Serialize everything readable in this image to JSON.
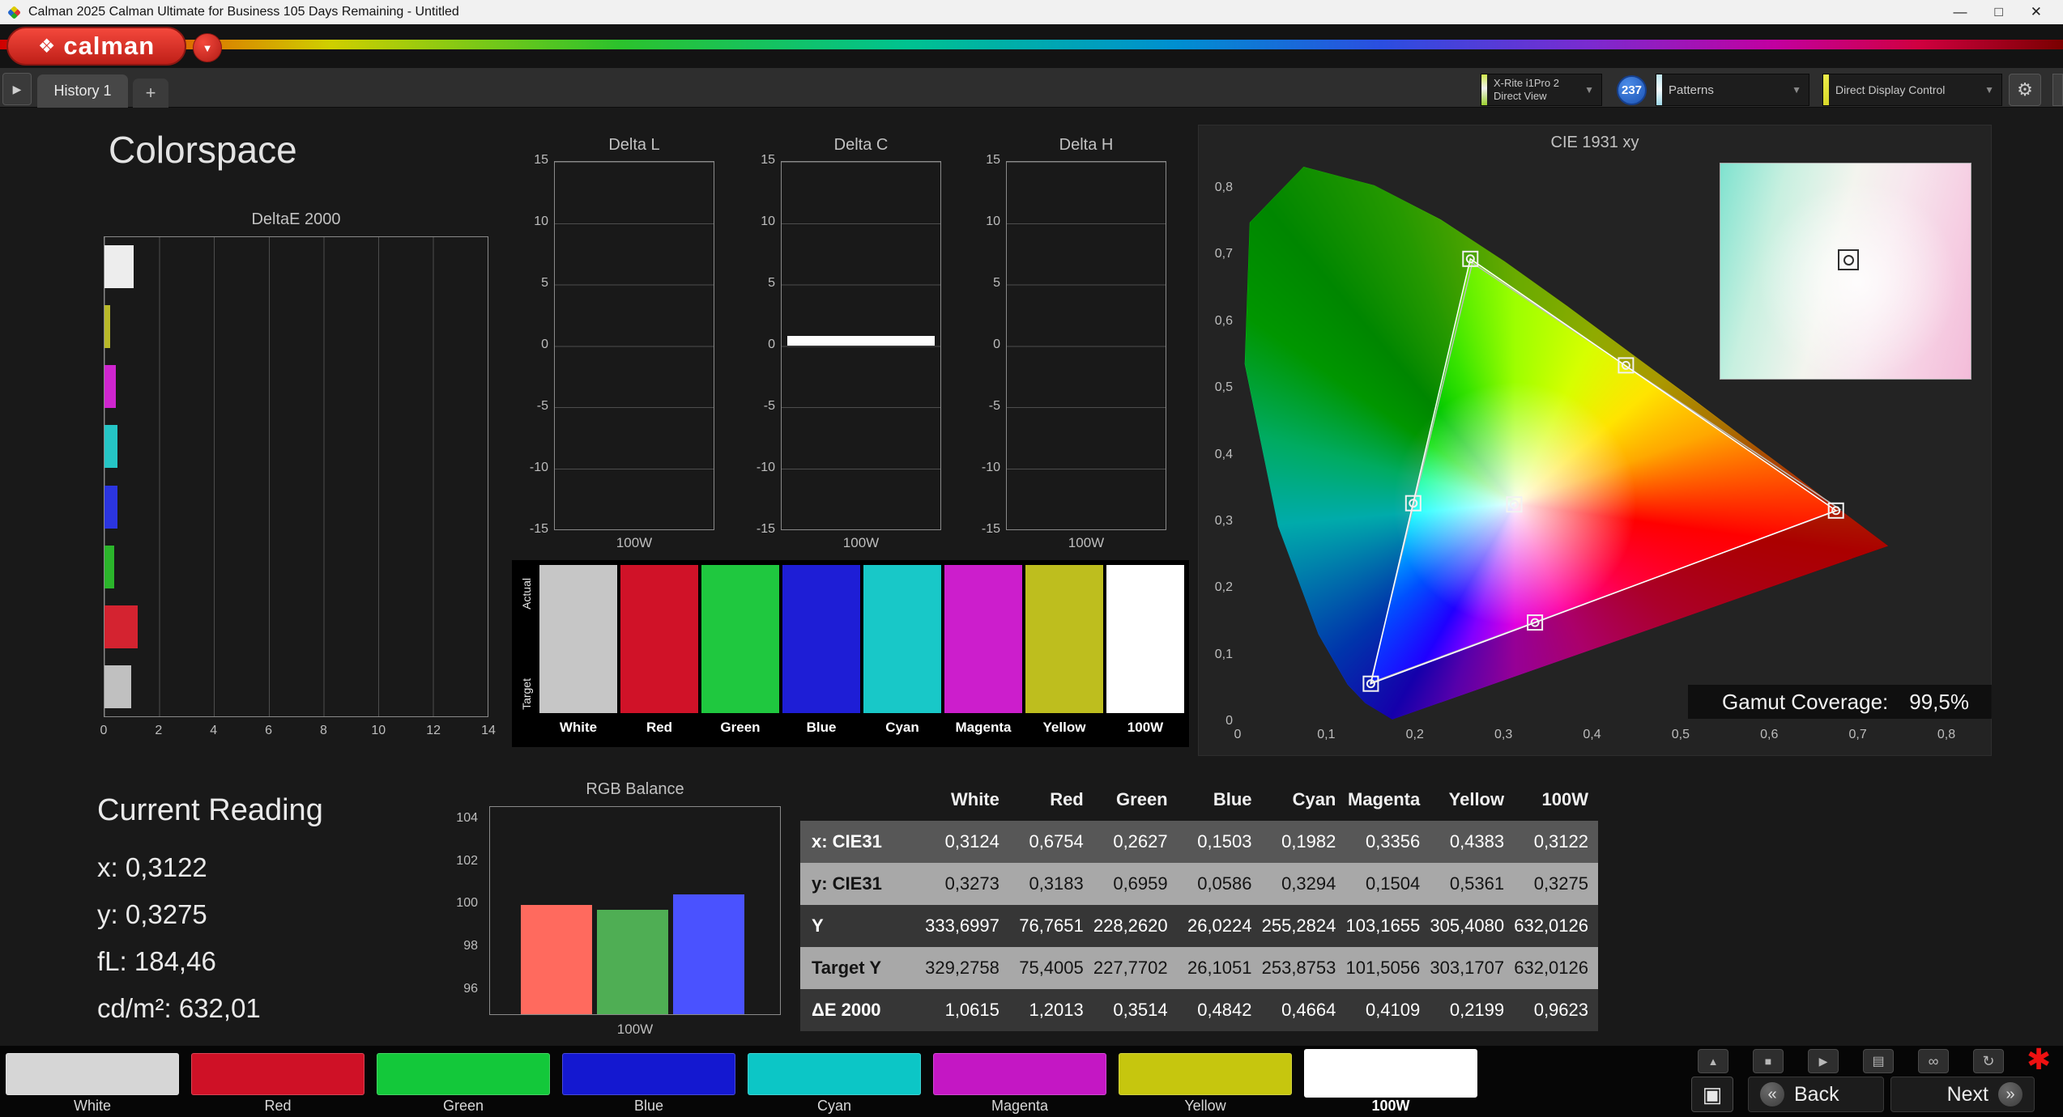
{
  "icons": {
    "flower": "❖",
    "caret": "▼",
    "toggle": "▶",
    "gear": "⚙",
    "minimize": "—",
    "maximize": "□",
    "close": "✕",
    "up": "▲",
    "stop": "■",
    "play": "▶",
    "save": "▤",
    "link": "∞",
    "refresh": "↻",
    "asterisk": "✱",
    "back": "«",
    "next": "»",
    "window": "▣"
  },
  "window": {
    "title": "Calman 2025 Calman Ultimate for Business 105 Days Remaining  - Untitled"
  },
  "brand": {
    "name": "calman"
  },
  "tabbar": {
    "history_tab": "History 1",
    "add_tab": "+",
    "meter_line1": "X-Rite i1Pro 2",
    "meter_line2": "Direct View",
    "badge": "237",
    "patterns": "Patterns",
    "display_control": "Direct Display Control"
  },
  "page": {
    "title": "Colorspace"
  },
  "deltae2000": {
    "type": "bar",
    "title": "DeltaE 2000",
    "xmax": 14,
    "xticks": [
      "0",
      "2",
      "4",
      "6",
      "8",
      "10",
      "12",
      "14"
    ],
    "bars": [
      {
        "name": "White",
        "color": "#ededed",
        "value": 1.0615
      },
      {
        "name": "Yellow",
        "color": "#b9b929",
        "value": 0.2199
      },
      {
        "name": "Magenta",
        "color": "#cf25cf",
        "value": 0.4109
      },
      {
        "name": "Cyan",
        "color": "#25c5c5",
        "value": 0.4664
      },
      {
        "name": "Blue",
        "color": "#2b35e0",
        "value": 0.4842
      },
      {
        "name": "Green",
        "color": "#2bb52b",
        "value": 0.3514
      },
      {
        "name": "Red",
        "color": "#d42330",
        "value": 1.2013
      },
      {
        "name": "100W",
        "color": "#c0c0c0",
        "value": 0.9623
      }
    ]
  },
  "delta_charts": [
    {
      "title": "Delta L",
      "yticks": [
        "15",
        "10",
        "5",
        "0",
        "-5",
        "-10",
        "-15"
      ],
      "xlabel": "100W",
      "bar": null
    },
    {
      "title": "Delta C",
      "yticks": [
        "15",
        "10",
        "5",
        "0",
        "-5",
        "-10",
        "-15"
      ],
      "xlabel": "100W",
      "bar": 0.8
    },
    {
      "title": "Delta H",
      "yticks": [
        "15",
        "10",
        "5",
        "0",
        "-5",
        "-10",
        "-15"
      ],
      "xlabel": "100W",
      "bar": null
    }
  ],
  "swatches": {
    "row_labels": [
      "Actual",
      "Target"
    ],
    "columns": [
      {
        "label": "White",
        "color": "#c6c6c6"
      },
      {
        "label": "Red",
        "color": "#d01228"
      },
      {
        "label": "Green",
        "color": "#1fc83f"
      },
      {
        "label": "Blue",
        "color": "#1e1ed6"
      },
      {
        "label": "Cyan",
        "color": "#18c8c8"
      },
      {
        "label": "Magenta",
        "color": "#cc1ecc"
      },
      {
        "label": "Yellow",
        "color": "#bebe1e"
      },
      {
        "label": "100W",
        "color": "#ffffff"
      }
    ]
  },
  "cie": {
    "title": "CIE 1931 xy",
    "coverage_label": "Gamut Coverage:",
    "coverage_value": "99,5%",
    "xticks": [
      "0",
      "0,1",
      "0,2",
      "0,3",
      "0,4",
      "0,5",
      "0,6",
      "0,7",
      "0,8"
    ],
    "yticks": [
      "0",
      "0,1",
      "0,2",
      "0,3",
      "0,4",
      "0,5",
      "0,6",
      "0,7",
      "0,8"
    ],
    "points": {
      "white": [
        0.3122,
        0.3275
      ],
      "red": [
        0.6754,
        0.3183
      ],
      "green": [
        0.2627,
        0.6959
      ],
      "blue": [
        0.1503,
        0.0586
      ],
      "cyan": [
        0.1982,
        0.3294
      ],
      "magenta": [
        0.3356,
        0.1504
      ],
      "yellow": [
        0.4383,
        0.5361
      ]
    },
    "target_triangle": [
      [
        0.68,
        0.32
      ],
      [
        0.265,
        0.69
      ],
      [
        0.15,
        0.06
      ]
    ]
  },
  "reading": {
    "title": "Current Reading",
    "lines": [
      "x: 0,3122",
      "y: 0,3275",
      "fL: 184,46",
      "cd/m²: 632,01"
    ]
  },
  "rgb_balance": {
    "type": "bar",
    "title": "RGB Balance",
    "xlabel": "100W",
    "ymin": 94.9,
    "ymax": 104.6,
    "yticks": [
      "104",
      "102",
      "100",
      "98",
      "96"
    ],
    "bars": [
      {
        "name": "red",
        "color": "#ff6a5e",
        "value": 100.0
      },
      {
        "name": "green",
        "color": "#4fae54",
        "value": 99.8
      },
      {
        "name": "blue",
        "color": "#4a52ff",
        "value": 100.5
      }
    ]
  },
  "table": {
    "col_headers": [
      "White",
      "Red",
      "Green",
      "Blue",
      "Cyan",
      "Magenta",
      "Yellow",
      "100W"
    ],
    "rows": [
      {
        "label": "x: CIE31",
        "values": [
          "0,3124",
          "0,6754",
          "0,2627",
          "0,1503",
          "0,1982",
          "0,3356",
          "0,4383",
          "0,3122"
        ]
      },
      {
        "label": "y: CIE31",
        "values": [
          "0,3273",
          "0,3183",
          "0,6959",
          "0,0586",
          "0,3294",
          "0,1504",
          "0,5361",
          "0,3275"
        ]
      },
      {
        "label": "Y",
        "values": [
          "333,6997",
          "76,7651",
          "228,2620",
          "26,0224",
          "255,2824",
          "103,1655",
          "305,4080",
          "632,0126"
        ]
      },
      {
        "label": "Target Y",
        "values": [
          "329,2758",
          "75,4005",
          "227,7702",
          "26,1051",
          "253,8753",
          "101,5056",
          "303,1707",
          "632,0126"
        ]
      },
      {
        "label": "ΔE 2000",
        "values": [
          "1,0615",
          "1,2013",
          "0,3514",
          "0,4842",
          "0,4664",
          "0,4109",
          "0,2199",
          "0,9623"
        ]
      }
    ]
  },
  "bottom_bar": {
    "buttons": [
      {
        "label": "White",
        "color": "#d6d6d6",
        "selected": false
      },
      {
        "label": "Red",
        "color": "#cf1126",
        "selected": false
      },
      {
        "label": "Green",
        "color": "#13c83a",
        "selected": false
      },
      {
        "label": "Blue",
        "color": "#1418d0",
        "selected": false
      },
      {
        "label": "Cyan",
        "color": "#0cc6c6",
        "selected": false
      },
      {
        "label": "Magenta",
        "color": "#c417c4",
        "selected": false
      },
      {
        "label": "Yellow",
        "color": "#c6c60e",
        "selected": false
      },
      {
        "label": "100W",
        "color": "#ffffff",
        "selected": true
      }
    ],
    "back": "Back",
    "next": "Next"
  }
}
